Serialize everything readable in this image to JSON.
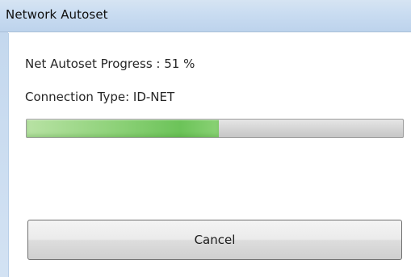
{
  "window": {
    "title": "Network Autoset"
  },
  "status": {
    "progress_text": "Net Autoset Progress : 51 %",
    "connection_text": "Connection Type: ID-NET",
    "progress_fraction": 0.51
  },
  "actions": {
    "cancel_label": "Cancel"
  },
  "colors": {
    "titlebar": "#c9dcf1",
    "progress_fill": "#6cc359",
    "progress_track": "#d5d5d5"
  }
}
